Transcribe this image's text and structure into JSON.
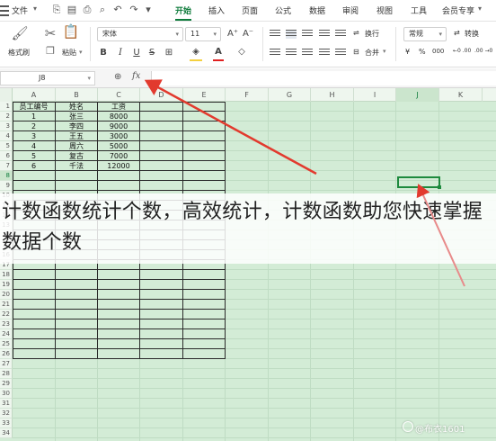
{
  "menubar": {
    "file_label": "文件",
    "tabs": [
      "开始",
      "插入",
      "页面",
      "公式",
      "数据",
      "审阅",
      "视图",
      "工具",
      "会员专享"
    ]
  },
  "ribbon": {
    "format_painter_label": "格式刷",
    "paste_label": "粘贴",
    "font_name": "宋体",
    "font_size": "11",
    "font_grow": "A⁺",
    "font_shrink": "A⁻",
    "wrap_label": "换行",
    "merge_label": "合并",
    "number_format": "常规",
    "convert_label": "转换",
    "percent_symbol": "%",
    "thousands_symbol": "000",
    "dec_increase": "←0 .00",
    "dec_decrease": ".00 →0",
    "bold": "B",
    "italic": "I",
    "underline": "U",
    "strike": "S"
  },
  "formula_bar": {
    "cell_ref": "J8",
    "fx_label": "fx",
    "value": ""
  },
  "grid": {
    "columns": [
      "A",
      "B",
      "C",
      "D",
      "E",
      "F",
      "G",
      "H",
      "I",
      "J",
      "K"
    ],
    "selected_column": "J",
    "rows": [
      "1",
      "2",
      "3",
      "4",
      "5",
      "6",
      "7",
      "8",
      "9",
      "10",
      "11",
      "12",
      "13",
      "14",
      "15",
      "16",
      "17",
      "18",
      "19",
      "20",
      "21",
      "22",
      "23",
      "24",
      "25",
      "26",
      "27",
      "28",
      "29",
      "30",
      "31",
      "32",
      "33",
      "34"
    ],
    "selected_row": "8",
    "header_row": [
      "员工编号",
      "姓名",
      "工资"
    ],
    "data": [
      [
        "1",
        "张三",
        "8000"
      ],
      [
        "2",
        "李四",
        "9000"
      ],
      [
        "3",
        "王五",
        "3000"
      ],
      [
        "4",
        "周六",
        "5000"
      ],
      [
        "5",
        "复古",
        "7000"
      ],
      [
        "6",
        "千法",
        "12000"
      ]
    ]
  },
  "caption": {
    "text": "计数函数统计个数，高效统计，计数函数助您快速掌握数据个数"
  },
  "watermark": {
    "text": "@布衣1601"
  }
}
